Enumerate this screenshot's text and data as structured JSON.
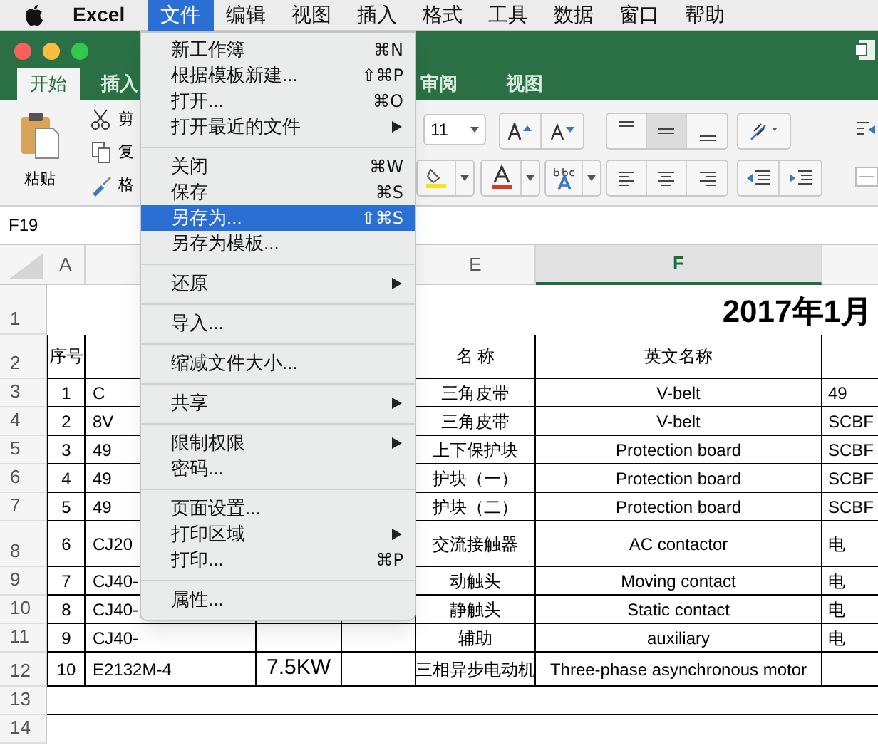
{
  "menubar": {
    "app": "Excel",
    "items": [
      {
        "label": "文件",
        "selected": true
      },
      {
        "label": "编辑",
        "selected": false
      },
      {
        "label": "视图",
        "selected": false
      },
      {
        "label": "插入",
        "selected": false
      },
      {
        "label": "格式",
        "selected": false
      },
      {
        "label": "工具",
        "selected": false
      },
      {
        "label": "数据",
        "selected": false
      },
      {
        "label": "窗口",
        "selected": false
      },
      {
        "label": "帮助",
        "selected": false
      }
    ]
  },
  "file_menu": {
    "groups": [
      [
        {
          "label": "新工作簿",
          "shortcut": "⌘N",
          "submenu": false,
          "selected": false
        },
        {
          "label": "根据模板新建...",
          "shortcut": "⇧⌘P",
          "submenu": false,
          "selected": false
        },
        {
          "label": "打开...",
          "shortcut": "⌘O",
          "submenu": false,
          "selected": false
        },
        {
          "label": "打开最近的文件",
          "submenu": true,
          "selected": false
        }
      ],
      [
        {
          "label": "关闭",
          "shortcut": "⌘W",
          "submenu": false,
          "selected": false
        },
        {
          "label": "保存",
          "shortcut": "⌘S",
          "submenu": false,
          "selected": false
        },
        {
          "label": "另存为...",
          "shortcut": "⇧⌘S",
          "submenu": false,
          "selected": true
        },
        {
          "label": "另存为模板...",
          "submenu": false,
          "selected": false
        }
      ],
      [
        {
          "label": "还原",
          "submenu": true,
          "selected": false
        }
      ],
      [
        {
          "label": "导入...",
          "submenu": false,
          "selected": false
        }
      ],
      [
        {
          "label": "缩减文件大小...",
          "submenu": false,
          "selected": false
        }
      ],
      [
        {
          "label": "共享",
          "submenu": true,
          "selected": false
        }
      ],
      [
        {
          "label": "限制权限",
          "submenu": true,
          "selected": false
        },
        {
          "label": "密码...",
          "submenu": false,
          "selected": false
        }
      ],
      [
        {
          "label": "页面设置...",
          "submenu": false,
          "selected": false
        },
        {
          "label": "打印区域",
          "submenu": true,
          "selected": false
        },
        {
          "label": "打印...",
          "shortcut": "⌘P",
          "submenu": false,
          "selected": false
        }
      ],
      [
        {
          "label": "属性...",
          "submenu": false,
          "selected": false
        }
      ]
    ]
  },
  "ribbon": {
    "tabs": [
      {
        "label": "开始",
        "selected": true
      },
      {
        "label": "插入",
        "selected": false
      },
      {
        "label": "审阅",
        "selected": false
      },
      {
        "label": "视图",
        "selected": false
      }
    ],
    "paste_label": "粘贴",
    "clipboard": [
      "剪",
      "复",
      "格"
    ],
    "font_size": "11",
    "vertical_align": [
      {
        "selected": false
      },
      {
        "selected": true
      },
      {
        "selected": false
      }
    ]
  },
  "name_box": "F19",
  "sheet": {
    "columns": [
      {
        "label": "A",
        "selected": false
      },
      {
        "label": "E",
        "selected": false
      },
      {
        "label": "F",
        "selected": true
      }
    ],
    "title": "2017年1月",
    "rows": [
      {
        "number": "1"
      },
      {
        "number": "2",
        "a": "序号",
        "e": "名 称",
        "f": "英文名称"
      },
      {
        "number": "3",
        "a": "1",
        "b": "C",
        "e": "三角皮带",
        "f": "V-belt",
        "g": "49"
      },
      {
        "number": "4",
        "a": "2",
        "b": "8V",
        "e": "三角皮带",
        "f": "V-belt",
        "g": "SCBF"
      },
      {
        "number": "5",
        "a": "3",
        "b": "49",
        "e": "上下保护块",
        "f": "Protection board",
        "g": "SCBF"
      },
      {
        "number": "6",
        "a": "4",
        "b": "49",
        "e": "护块（一）",
        "f": "Protection board",
        "g": "SCBF"
      },
      {
        "number": "7",
        "a": "5",
        "b": "49",
        "e": "护块（二）",
        "f": "Protection board",
        "g": "SCBF"
      },
      {
        "number": "8",
        "a": "6",
        "b": "CJ20",
        "e": "交流接触器",
        "f": "AC contactor",
        "g": "电"
      },
      {
        "number": "9",
        "a": "7",
        "b": "CJ40-",
        "e": "动触头",
        "f": "Moving contact",
        "g": "电"
      },
      {
        "number": "10",
        "a": "8",
        "b": "CJ40-",
        "e": "静触头",
        "f": "Static contact",
        "g": "电"
      },
      {
        "number": "11",
        "a": "9",
        "b": "CJ40-",
        "e": "辅助",
        "f": "auxiliary",
        "g": "电"
      },
      {
        "number": "12",
        "a": "10",
        "b": "E2132M-4",
        "c": "7.5KW",
        "e": "三相异步电动机",
        "f": "Three-phase asynchronous motor"
      },
      {
        "number": "13"
      },
      {
        "number": "14"
      }
    ]
  }
}
